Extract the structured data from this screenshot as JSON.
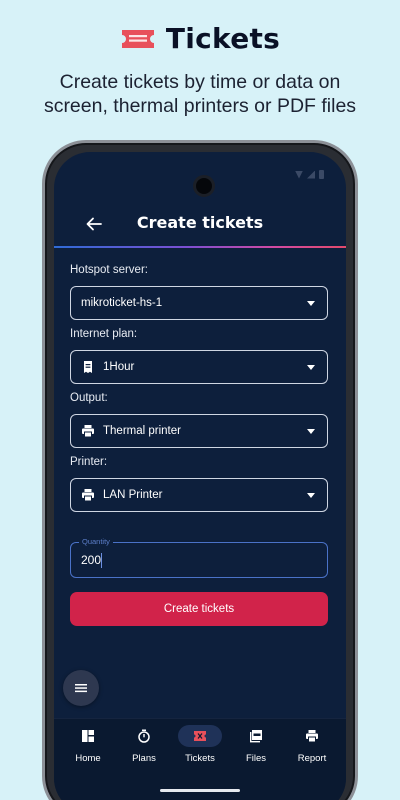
{
  "promo": {
    "title": "Tickets",
    "subtitle_line1": "Create tickets by time or data on",
    "subtitle_line2": "screen, thermal printers or PDF files",
    "icon": "ticket-icon"
  },
  "app_bar": {
    "title": "Create tickets",
    "back_icon": "arrow-back-icon"
  },
  "form": {
    "hotspot": {
      "label": "Hotspot server:",
      "value": "mikroticket-hs-1"
    },
    "plan": {
      "label": "Internet plan:",
      "value": "1Hour",
      "icon": "receipt-icon"
    },
    "output": {
      "label": "Output:",
      "value": "Thermal printer",
      "icon": "printer-icon"
    },
    "printer": {
      "label": "Printer:",
      "value": "LAN Printer",
      "icon": "printer-icon"
    },
    "quantity": {
      "label": "Quantity",
      "value": "200"
    },
    "submit_label": "Create tickets"
  },
  "fab": {
    "icon": "menu-icon"
  },
  "nav": {
    "items": [
      {
        "label": "Home",
        "icon": "dashboard-icon",
        "active": false
      },
      {
        "label": "Plans",
        "icon": "timer-icon",
        "active": false
      },
      {
        "label": "Tickets",
        "icon": "ticket-icon",
        "active": true
      },
      {
        "label": "Files",
        "icon": "pdf-file-icon",
        "active": false
      },
      {
        "label": "Report",
        "icon": "report-icon",
        "active": false
      }
    ]
  },
  "colors": {
    "background": "#d7f2f8",
    "screen": "#0d1f3c",
    "accent": "#d1234a",
    "focus": "#4a72c8",
    "promo_icon": "#e8505b"
  }
}
